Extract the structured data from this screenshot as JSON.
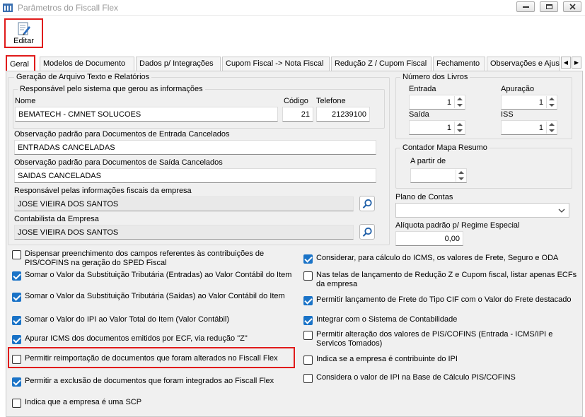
{
  "window": {
    "title": "Parâmetros do Fiscall Flex"
  },
  "toolbar": {
    "edit_label": "Editar"
  },
  "tabs": [
    {
      "label": "Geral"
    },
    {
      "label": "Modelos de Documento"
    },
    {
      "label": "Dados p/ Integrações"
    },
    {
      "label": "Cupom Fiscal -> Nota Fiscal"
    },
    {
      "label": "Redução Z / Cupom Fiscal"
    },
    {
      "label": "Fechamento"
    },
    {
      "label": "Observações e Ajus"
    }
  ],
  "geracao": {
    "title": "Geração de Arquivo Texto e Relatórios",
    "responsavel_title": "Responsável pelo sistema que gerou as informações",
    "nome_label": "Nome",
    "nome_value": "BEMATECH - CMNET SOLUCOES",
    "codigo_label": "Código",
    "codigo_value": "21",
    "telefone_label": "Telefone",
    "telefone_value": "21239100",
    "obs_entrada_label": "Observação padrão para Documentos de Entrada Cancelados",
    "obs_entrada_value": "ENTRADAS CANCELADAS",
    "obs_saida_label": "Observação padrão para Documentos de Saída Cancelados",
    "obs_saida_value": "SAIDAS CANCELADAS",
    "resp_fiscal_label": "Responsável pelas informações fiscais da empresa",
    "resp_fiscal_value": "JOSE VIEIRA DOS SANTOS",
    "contabilista_label": "Contabilista da Empresa",
    "contabilista_value": "JOSE VIEIRA DOS SANTOS"
  },
  "livros": {
    "title": "Número dos Livros",
    "entrada_label": "Entrada",
    "entrada_value": "1",
    "apuracao_label": "Apuração",
    "apuracao_value": "1",
    "saida_label": "Saída",
    "saida_value": "1",
    "iss_label": "ISS",
    "iss_value": "1"
  },
  "mapa": {
    "title": "Contador Mapa Resumo",
    "apartir_label": "A partir de",
    "apartir_value": ""
  },
  "plano": {
    "label": "Plano de Contas",
    "value": ""
  },
  "aliquota": {
    "label": "Alíquota padrão p/ Regime Especial",
    "value": "0,00"
  },
  "checks_left": [
    {
      "label": "Dispensar preenchimento dos campos referentes às contribuições de PIS/COFINS na geração do SPED Fiscal",
      "checked": false
    },
    {
      "label": "Somar o Valor da Substituição Tributária (Entradas) ao Valor Contábil do Item",
      "checked": true
    },
    {
      "label": "Somar o Valor da Substituição Tributária (Saídas) ao Valor Contábil do Item",
      "checked": true
    },
    {
      "label": "Somar o Valor do IPI ao Valor Total do Item (Valor Contábil)",
      "checked": true
    },
    {
      "label": "Apurar ICMS dos documentos emitidos por ECF, via redução \"Z\"",
      "checked": true
    },
    {
      "label": "Permitir reimportação de documentos que foram alterados no Fiscall Flex",
      "checked": false
    },
    {
      "label": "Permitir a exclusão de documentos que foram integrados ao Fiscall Flex",
      "checked": true
    },
    {
      "label": "Indica que a empresa é uma SCP",
      "checked": false
    }
  ],
  "checks_right": [
    {
      "label": "Considerar, para cálculo do ICMS, os valores de Frete, Seguro e ODA",
      "checked": true
    },
    {
      "label": "Nas telas de lançamento de Redução Z e Cupom fiscal, listar apenas ECFs da empresa",
      "checked": false
    },
    {
      "label": "Permitir lançamento de Frete do Tipo CIF com o Valor do Frete destacado",
      "checked": true
    },
    {
      "label": "Integrar com o Sistema de Contabilidade",
      "checked": true
    },
    {
      "label": "Permitir alteração dos valores de PIS/COFINS (Entrada - ICMS/IPI e Servicos Tomados)",
      "checked": false
    },
    {
      "label": "Indica se a empresa é contribuinte do IPI",
      "checked": false
    },
    {
      "label": "Considera o valor de IPI na Base de Cálculo PIS/COFINS",
      "checked": false
    }
  ],
  "colors": {
    "accent_check": "#1a73c7",
    "highlight": "#e01b1b",
    "panel_bg": "#f0f0f0"
  },
  "icons": {
    "app": "app-icon",
    "edit": "edit-document-icon",
    "search": "search-icon",
    "dropdown": "chevron-down-icon"
  }
}
